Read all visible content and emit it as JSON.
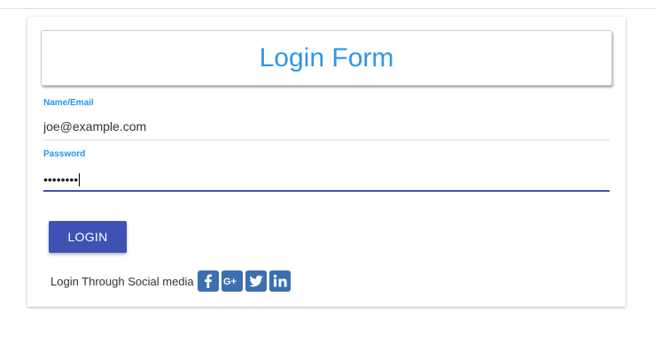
{
  "form": {
    "title": "Login Form",
    "email_label": "Name/Email",
    "email_value": "joe@example.com",
    "password_label": "Password",
    "password_masked": "••••••••",
    "login_button": "LOGIN",
    "social_text": "Login Through Social media"
  },
  "social": [
    {
      "icon": "facebook-icon",
      "glyph": "f"
    },
    {
      "icon": "google-plus-icon",
      "glyph": "G+"
    },
    {
      "icon": "twitter-icon",
      "glyph": "twitter bird"
    },
    {
      "icon": "linkedin-icon",
      "glyph": "in"
    }
  ],
  "colors": {
    "accent": "#2196f3",
    "title": "#2e97e6",
    "button": "#3f51b5",
    "social": "#3d6fae"
  }
}
